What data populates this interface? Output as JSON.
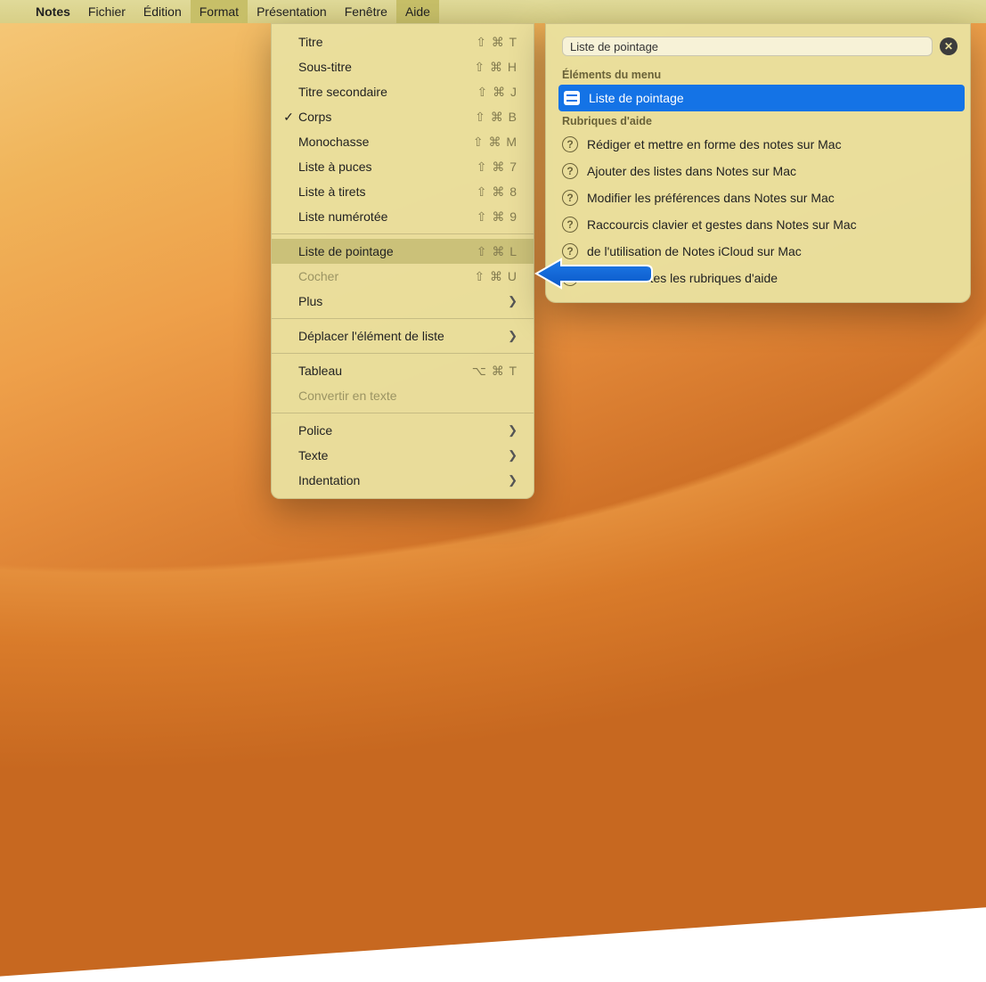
{
  "menubar": {
    "app": "Notes",
    "items": [
      "Fichier",
      "Édition",
      "Format",
      "Présentation",
      "Fenêtre",
      "Aide"
    ]
  },
  "format_menu": {
    "items": [
      {
        "label": "Titre",
        "shortcut": "⇧ ⌘ T"
      },
      {
        "label": "Sous-titre",
        "shortcut": "⇧ ⌘ H"
      },
      {
        "label": "Titre secondaire",
        "shortcut": "⇧ ⌘ J"
      },
      {
        "label": "Corps",
        "shortcut": "⇧ ⌘ B",
        "checked": true
      },
      {
        "label": "Monochasse",
        "shortcut": "⇧ ⌘ M"
      },
      {
        "label": "Liste à puces",
        "shortcut": "⇧ ⌘ 7"
      },
      {
        "label": "Liste à tirets",
        "shortcut": "⇧ ⌘ 8"
      },
      {
        "label": "Liste numérotée",
        "shortcut": "⇧ ⌘ 9"
      },
      {
        "label": "Liste de pointage",
        "shortcut": "⇧ ⌘ L",
        "highlighted": true
      },
      {
        "label": "Cocher",
        "shortcut": "⇧ ⌘ U",
        "disabled": true
      },
      {
        "label": "Plus",
        "submenu": true
      },
      {
        "label": "Déplacer l'élément de liste",
        "submenu": true
      },
      {
        "label": "Tableau",
        "shortcut": "⌥ ⌘ T",
        "alt": true
      },
      {
        "label": "Convertir en texte",
        "disabled": true
      },
      {
        "label": "Police",
        "submenu": true
      },
      {
        "label": "Texte",
        "submenu": true
      },
      {
        "label": "Indentation",
        "submenu": true
      }
    ]
  },
  "help_panel": {
    "search_value": "Liste de pointage",
    "menu_items_header": "Éléments du menu",
    "menu_item_result": "Liste de pointage",
    "help_topics_header": "Rubriques d'aide",
    "topics": [
      "Rédiger et mettre en forme des notes sur Mac",
      "Ajouter des listes dans Notes sur Mac",
      "Modifier les préférences dans Notes sur Mac",
      "Raccourcis clavier et gestes dans Notes sur Mac",
      "de l'utilisation de Notes iCloud sur Mac",
      "Afficher toutes les rubriques d'aide"
    ]
  }
}
